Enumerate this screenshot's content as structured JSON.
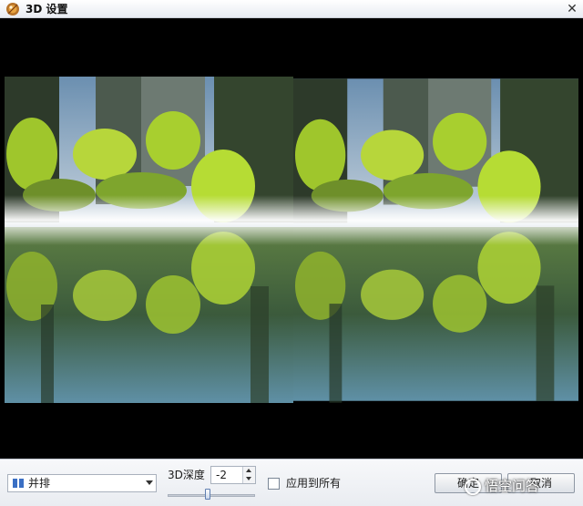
{
  "window": {
    "title": "3D 设置",
    "close_glyph": "✕"
  },
  "preview": {
    "layout": "side-by-side",
    "content": "forest-lake-reflection"
  },
  "controls": {
    "mode_select": {
      "selected": "并排",
      "icon": "stereo-pair-icon"
    },
    "depth_label": "3D深度",
    "depth_value": "-2",
    "depth_slider_fraction": 0.46,
    "apply_all_label": "应用到所有",
    "apply_all_checked": false,
    "ok_label": "确定",
    "cancel_label": "取消"
  },
  "watermark": {
    "text": "悟空问答"
  },
  "colors": {
    "accent": "#4a7fd0",
    "preview_bg": "#000000",
    "bottom_bar": "#eceff3"
  }
}
